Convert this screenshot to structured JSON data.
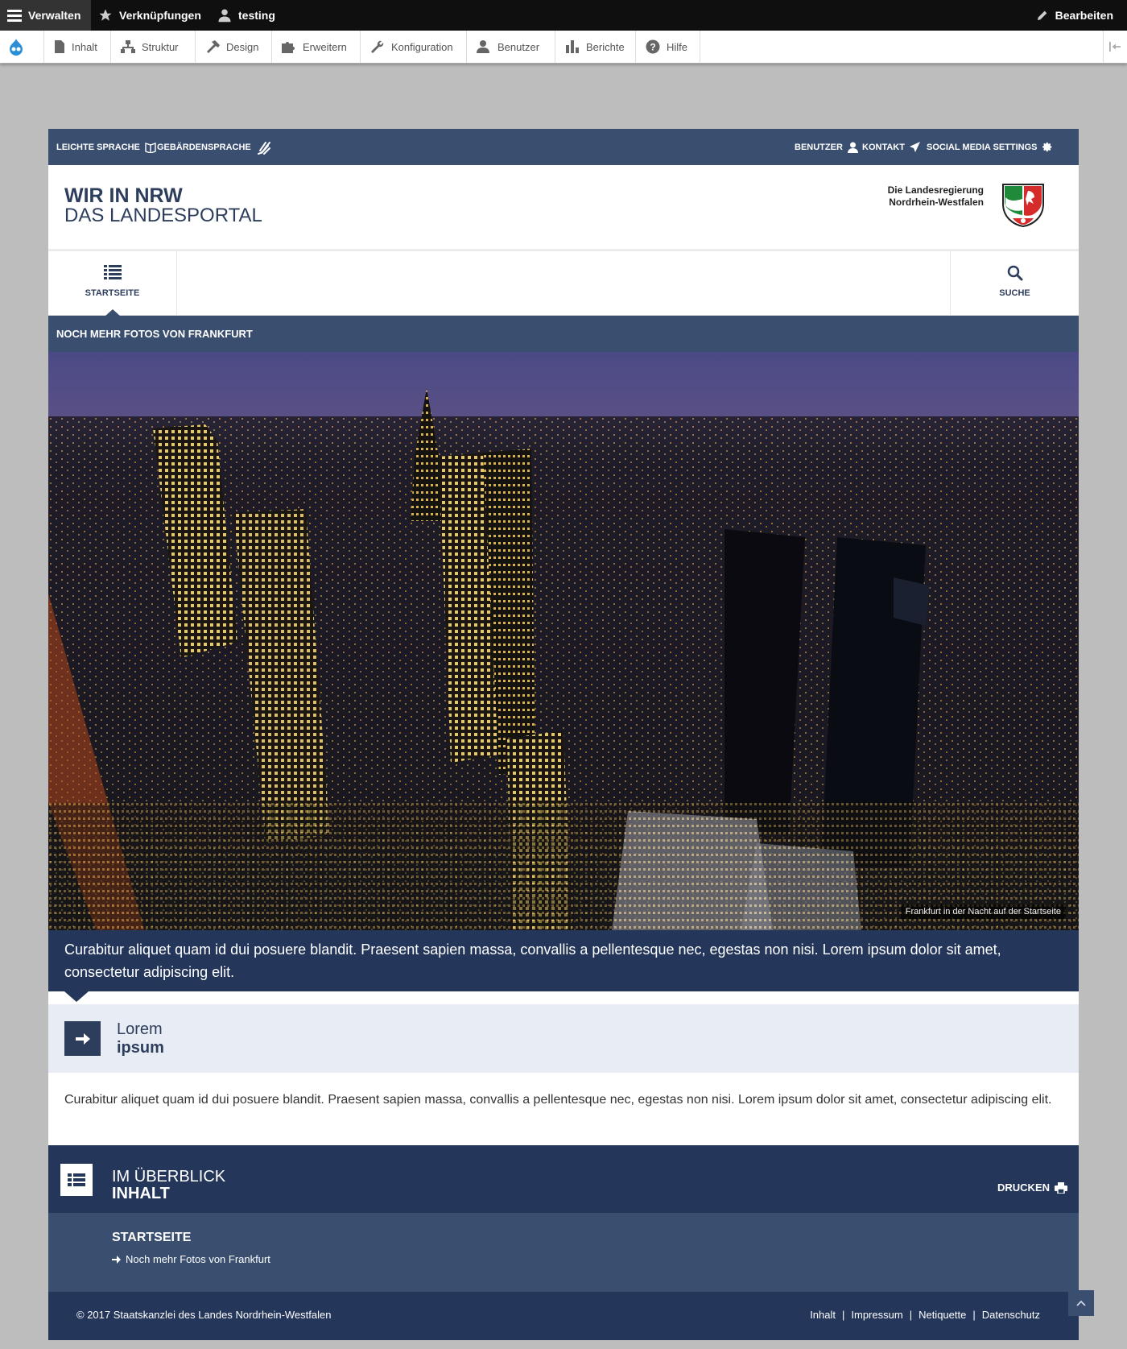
{
  "toolbar": {
    "manage": "Verwalten",
    "shortcuts": "Verknüpfungen",
    "user": "testing",
    "edit": "Bearbeiten"
  },
  "tray": {
    "items": [
      "Inhalt",
      "Struktur",
      "Design",
      "Erweitern",
      "Konfiguration",
      "Benutzer",
      "Berichte",
      "Hilfe"
    ]
  },
  "topbar": {
    "easy_language": "LEICHTE SPRACHE",
    "sign_language": "GEBÄRDENSPRACHE",
    "user": "BENUTZER",
    "contact": "KONTAKT",
    "social": "SOCIAL MEDIA SETTINGS"
  },
  "header": {
    "brand_line1": "WIR IN NRW",
    "brand_line2": "DAS LANDESPORTAL",
    "gov_line1": "Die Landesregierung",
    "gov_line2": "Nordrhein-Westfalen"
  },
  "nav": {
    "home": "STARTSEITE",
    "search": "SUCHE"
  },
  "breadcrumb": "NOCH MEHR FOTOS VON FRANKFURT",
  "hero": {
    "caption": "Frankfurt in der Nacht auf der Startseite"
  },
  "intro": "Curabitur aliquet quam id dui posuere blandit. Praesent sapien massa, convallis a pellentesque nec, egestas non nisi. Lorem ipsum dolor sit amet, consectetur adipiscing elit.",
  "teaser": {
    "line1": "Lorem",
    "line2": "ipsum"
  },
  "body_text": "Curabitur aliquet quam id dui posuere blandit. Praesent sapien massa, convallis a pellentesque nec, egestas non nisi. Lorem ipsum dolor sit amet, consectetur adipiscing elit.",
  "overview": {
    "line1": "IM ÜBERBLICK",
    "line2": "INHALT",
    "print": "DRUCKEN"
  },
  "toc": {
    "heading": "STARTSEITE",
    "link": "Noch mehr Fotos von Frankfurt"
  },
  "footer": {
    "copyright": "© 2017 Staatskanzlei des Landes Nordrhein-Westfalen",
    "links": [
      "Inhalt",
      "Impressum",
      "Netiquette",
      "Datenschutz"
    ]
  },
  "colors": {
    "primary": "#3a4f70",
    "dark": "#24365a",
    "teaser_bg": "#e8edf5"
  }
}
